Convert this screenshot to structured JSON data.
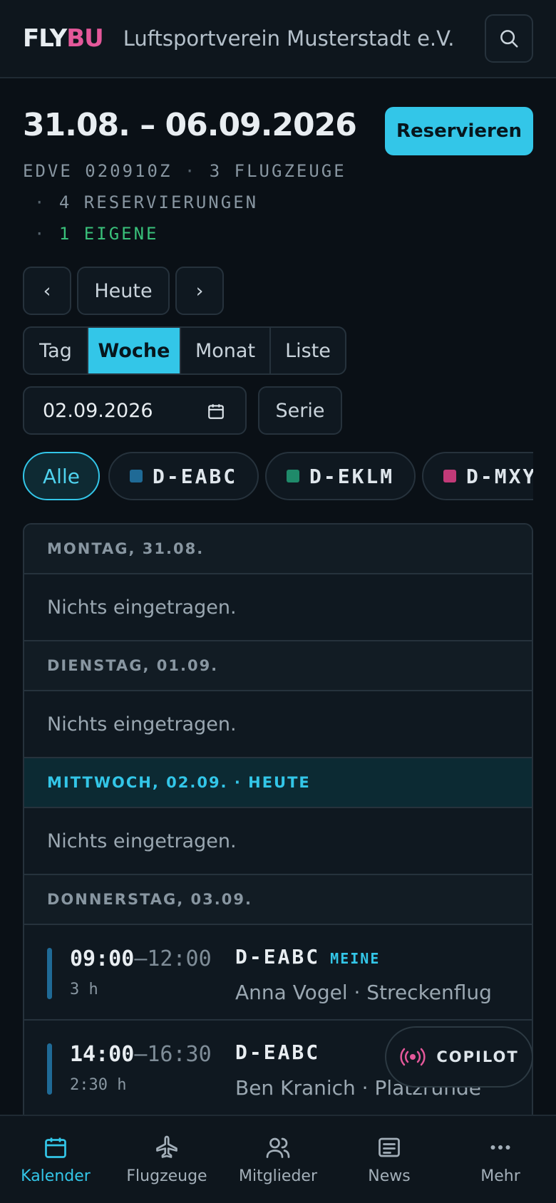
{
  "header": {
    "logo_part1": "FLY",
    "logo_part2": "BU",
    "club_name": "Luftsportverein Musterstadt e.V."
  },
  "week": {
    "title": "31.08. – 06.09.2026",
    "reserve_label": "Reservieren",
    "airfield": "EDVE 020910Z",
    "aircraft_count": "3 FLUGZEUGE",
    "reservations": "4 RESERVIERUNGEN",
    "own": "1 EIGENE"
  },
  "nav": {
    "prev": "‹",
    "today": "Heute",
    "next": "›"
  },
  "views": {
    "day": "Tag",
    "week": "Woche",
    "month": "Monat",
    "list": "Liste",
    "active": "Woche"
  },
  "date_picker": {
    "value": "02.09.2026",
    "series_label": "Serie"
  },
  "filters": {
    "all": "Alle",
    "aircraft": [
      {
        "reg": "D-EABC",
        "color": "#1f6a96"
      },
      {
        "reg": "D-EKLM",
        "color": "#1f8a6a"
      },
      {
        "reg": "D-MXY",
        "color": "#c23a78"
      }
    ]
  },
  "agenda": {
    "empty_text": "Nichts eingetragen.",
    "days": [
      {
        "label": "MONTAG, 31.08."
      },
      {
        "label": "DIENSTAG, 01.09."
      },
      {
        "label": "MITTWOCH, 02.09. · HEUTE"
      },
      {
        "label": "DONNERSTAG, 03.09."
      }
    ],
    "entries": [
      {
        "start": "09:00",
        "end": "12:00",
        "duration": "3 h",
        "reg": "D-EABC",
        "badge": "MEINE",
        "detail": "Anna Vogel · Streckenflug"
      },
      {
        "start": "14:00",
        "end": "16:30",
        "duration": "2:30 h",
        "reg": "D-EABC",
        "badge": "",
        "detail": "Ben Kranich · Platzrunde"
      }
    ]
  },
  "copilot_label": "COPILOT",
  "bottom_nav": {
    "calendar": "Kalender",
    "aircraft": "Flugzeuge",
    "members": "Mitglieder",
    "news": "News",
    "more": "Mehr"
  },
  "colors": {
    "accent": "#33c6e8",
    "brand_pink": "#e4589a",
    "own_green": "#39c07a"
  }
}
